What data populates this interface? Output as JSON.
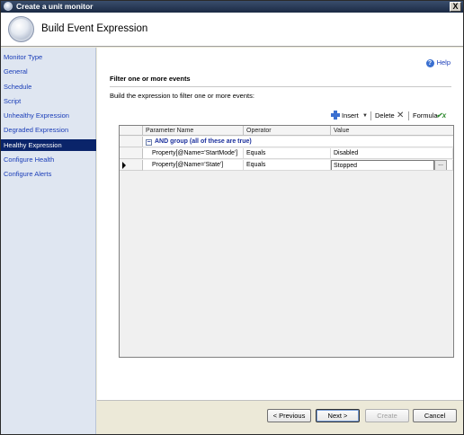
{
  "window": {
    "title": "Create a unit monitor",
    "close_glyph": "X"
  },
  "header": {
    "title": "Build Event Expression",
    "icon": "wizard-orb-icon"
  },
  "sidebar": {
    "items": [
      {
        "label": "Monitor Type",
        "selected": false
      },
      {
        "label": "General",
        "selected": false
      },
      {
        "label": "Schedule",
        "selected": false
      },
      {
        "label": "Script",
        "selected": false
      },
      {
        "label": "Unhealthy Expression",
        "selected": false
      },
      {
        "label": "Degraded Expression",
        "selected": false
      },
      {
        "label": "Healthy Expression",
        "selected": true
      },
      {
        "label": "Configure Health",
        "selected": false
      },
      {
        "label": "Configure Alerts",
        "selected": false
      }
    ]
  },
  "main": {
    "help_label": "Help",
    "section_title": "Filter one or more events",
    "instructions": "Build the expression to filter one or more events:",
    "toolbar": {
      "insert_label": "Insert",
      "delete_label": "Delete",
      "formula_label": "Formula"
    },
    "grid": {
      "columns": [
        "Parameter Name",
        "Operator",
        "Value"
      ],
      "group_label": "AND group (all of these are true)",
      "rows": [
        {
          "parameter": "Property[@Name='StartMode']",
          "operator": "Equals",
          "value": "Disabled"
        },
        {
          "parameter": "Property[@Name='State']",
          "operator": "Equals",
          "value": "Stopped"
        }
      ],
      "ellipsis": "..."
    }
  },
  "footer": {
    "previous_label": "< Previous",
    "next_label": "Next >",
    "create_label": "Create",
    "cancel_label": "Cancel"
  },
  "colors": {
    "selected_nav": "#0a246a",
    "link_blue": "#1a3db8",
    "sidebar_bg": "#dfe6f1",
    "group_text": "#1a2f9c"
  }
}
